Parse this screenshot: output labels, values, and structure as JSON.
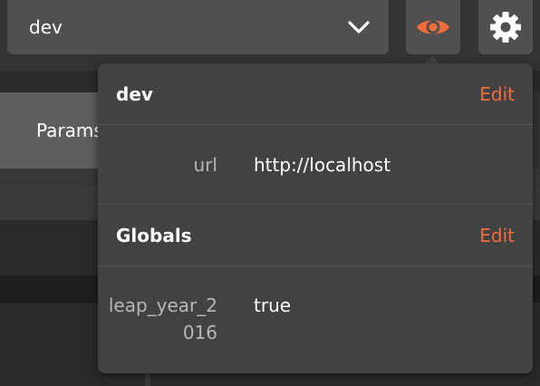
{
  "environment_selector": {
    "value": "dev"
  },
  "background": {
    "params_tab_label": "Params"
  },
  "popover": {
    "sections": [
      {
        "title": "dev",
        "edit_label": "Edit",
        "variables": [
          {
            "key": "url",
            "value": "http://localhost"
          }
        ]
      },
      {
        "title": "Globals",
        "edit_label": "Edit",
        "variables": [
          {
            "key": "leap_year_2016",
            "value": "true"
          }
        ]
      }
    ]
  },
  "colors": {
    "accent": "#f26b3a",
    "popover_bg": "#424242",
    "toolbar_bg": "#505050",
    "app_bg": "#333333"
  },
  "icons": [
    "chevron-down-icon",
    "eye-icon",
    "gear-icon"
  ]
}
